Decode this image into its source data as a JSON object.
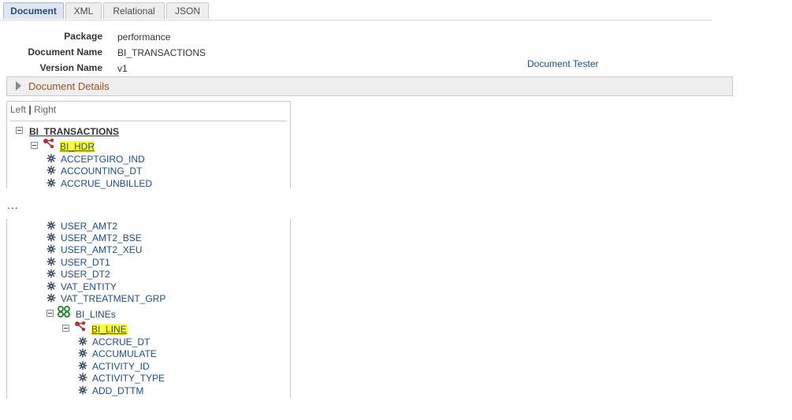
{
  "tabs": [
    {
      "label": "Document"
    },
    {
      "label": "XML"
    },
    {
      "label": "Relational"
    },
    {
      "label": "JSON"
    }
  ],
  "header": {
    "package_label": "Package",
    "package_value": "performance",
    "document_name_label": "Document Name",
    "document_name_value": "BI_TRANSACTIONS",
    "version_name_label": "Version Name",
    "version_name_value": "v1",
    "document_tester_link": "Document Tester"
  },
  "details": {
    "label": "Document Details"
  },
  "view_toggle": {
    "left": "Left",
    "separator": "|",
    "right": "Right"
  },
  "ellipsis": "...",
  "tree_top": {
    "root": "BI_TRANSACTIONS",
    "hdr": "BI_HDR",
    "fields": [
      "ACCEPTGIRO_IND",
      "ACCOUNTING_DT",
      "ACCRUE_UNBILLED"
    ]
  },
  "tree_bottom": {
    "fields": [
      "USER_AMT2",
      "USER_AMT2_BSE",
      "USER_AMT2_XEU",
      "USER_DT1",
      "USER_DT2",
      "VAT_ENTITY",
      "VAT_TREATMENT_GRP"
    ],
    "collection": "BI_LINEs",
    "line": "BI_LINE",
    "line_fields": [
      "ACCRUE_DT",
      "ACCUMULATE",
      "ACTIVITY_ID",
      "ACTIVITY_TYPE",
      "ADD_DTTM"
    ]
  },
  "icons": {
    "field": "field-gear-icon",
    "segment": "segment-node-icon",
    "collection": "collection-icon",
    "collapse": "collapse-minus-icon"
  },
  "colors": {
    "link": "#1c4d87",
    "highlight": "#ffff33",
    "details_text": "#a0521d",
    "segment_icon": "#b0323b",
    "collection_icon": "#2e8b3c"
  }
}
